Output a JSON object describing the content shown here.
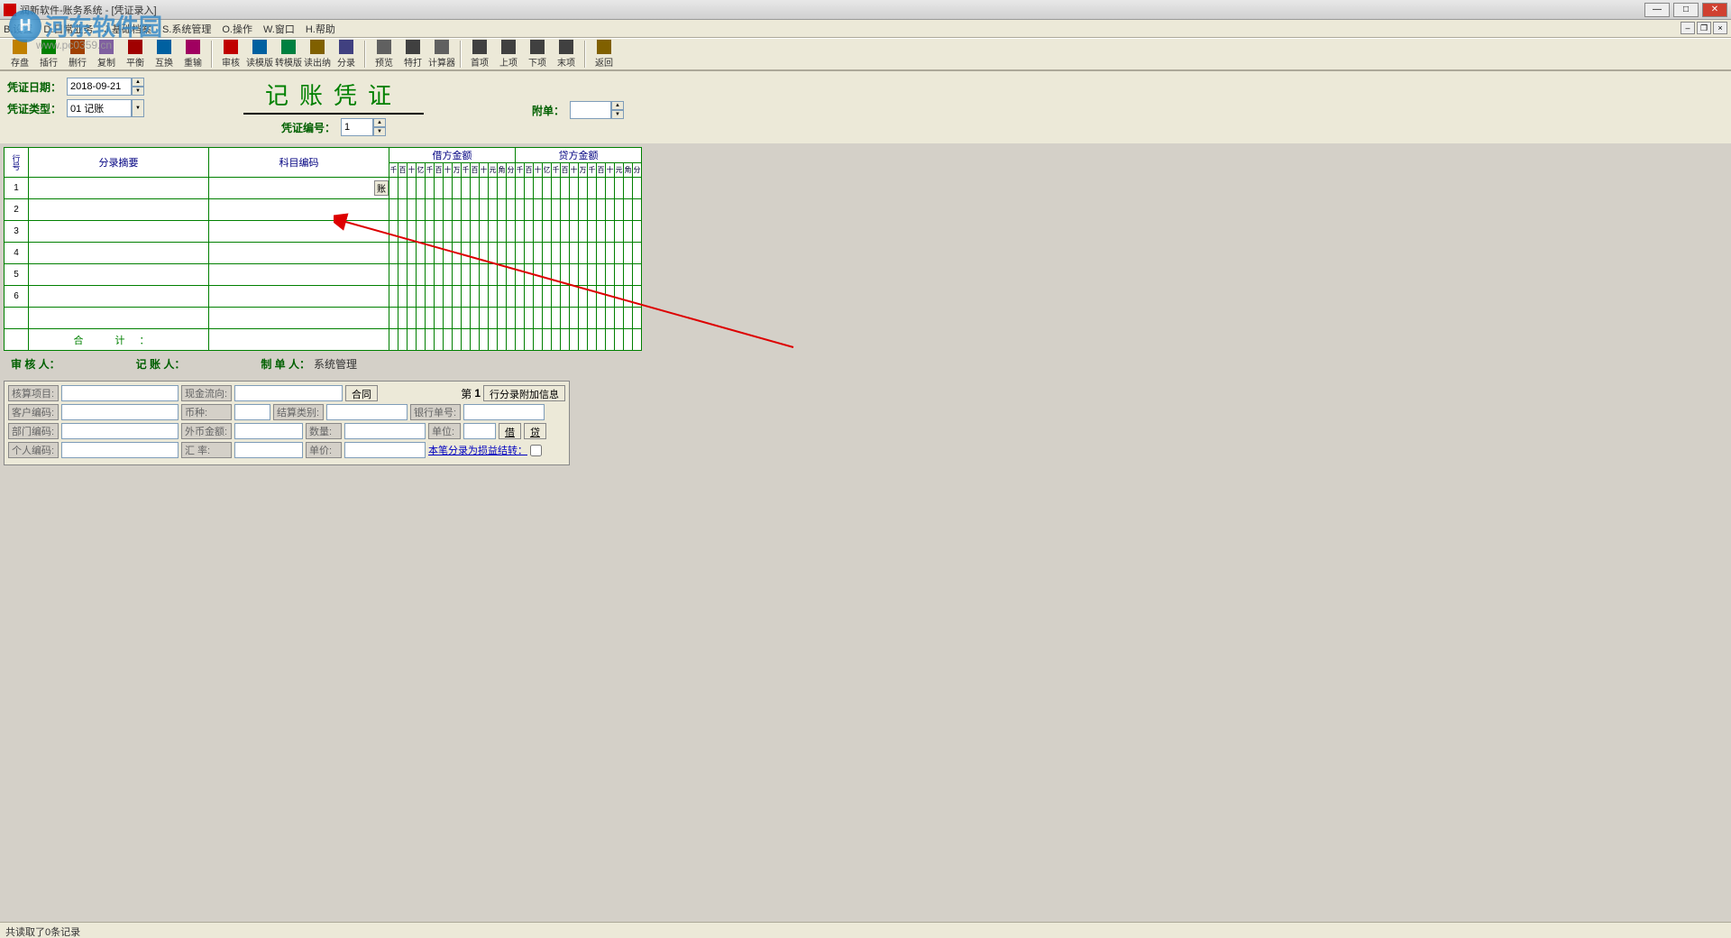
{
  "window": {
    "title": "润新软件-账务系统 - [凭证录入]"
  },
  "menu": {
    "items": [
      "B.设置",
      "D.日常业务",
      "J.基础档案",
      "S.系统管理",
      "O.操作",
      "W.窗口",
      "H.帮助"
    ]
  },
  "watermark": {
    "logo_text": "河东软件园",
    "url": "www.pc0359.cn",
    "logo_badge": "H"
  },
  "toolbar": {
    "groups": [
      [
        "存盘",
        "插行",
        "删行",
        "复制",
        "平衡",
        "互换",
        "重输"
      ],
      [
        "审核",
        "读模版",
        "转模版",
        "读出纳",
        "分录"
      ],
      [
        "预览",
        "特打",
        "计算器"
      ],
      [
        "首项",
        "上项",
        "下项",
        "末项"
      ],
      [
        "返回"
      ]
    ],
    "icons": [
      [
        "save",
        "insert-row",
        "delete-row",
        "copy",
        "balance",
        "swap",
        "redo"
      ],
      [
        "check",
        "read-tmpl",
        "to-tmpl",
        "read-cash",
        "entry"
      ],
      [
        "preview",
        "print",
        "calc"
      ],
      [
        "first",
        "prev",
        "next",
        "last"
      ],
      [
        "back"
      ]
    ],
    "colors": [
      [
        "#c08000",
        "#008000",
        "#a04000",
        "#8060a0",
        "#a00000",
        "#0060a0",
        "#a00060"
      ],
      [
        "#c00000",
        "#0060a0",
        "#008040",
        "#806000",
        "#404080"
      ],
      [
        "#606060",
        "#404040",
        "#606060"
      ],
      [
        "#404040",
        "#404040",
        "#404040",
        "#404040"
      ],
      [
        "#806000"
      ]
    ]
  },
  "form": {
    "date_label": "凭证日期：",
    "date_value": "2018-09-21",
    "type_label": "凭证类型：",
    "type_value": "01 记账",
    "title": "记账凭证",
    "num_label": "凭证编号：",
    "num_value": "1",
    "attach_label": "附单：",
    "attach_value": ""
  },
  "grid": {
    "col_xh": "行号",
    "col_summary": "分录摘要",
    "col_subject": "科目编码",
    "col_debit": "借方金额",
    "col_credit": "贷方金额",
    "digit_hdr": [
      "千",
      "百",
      "十",
      "亿",
      "千",
      "百",
      "十",
      "万",
      "千",
      "百",
      "十",
      "元",
      "角",
      "分"
    ],
    "zhang_btn": "账",
    "rows": [
      1,
      2,
      3,
      4,
      5,
      6
    ],
    "total_label": "合  计："
  },
  "signers": {
    "audit": "审 核 人：",
    "audit_v": "",
    "book": "记 账 人：",
    "book_v": "",
    "make": "制 单 人：",
    "make_v": "系统管理"
  },
  "panel": {
    "r1": {
      "l1": "核算项目:",
      "l2": "现金流向:",
      "btn": "合同",
      "num_lbl": "第",
      "num": "1",
      "btn2": "行分录附加信息"
    },
    "r2": {
      "l1": "客户编码:",
      "l2": "币种:",
      "l3": "结算类别:",
      "l4": "银行单号:"
    },
    "r3": {
      "l1": "部门编码:",
      "l2": "外币金额:",
      "l3": "数量:",
      "l4": "单位:",
      "btn1": "借",
      "btn2": "贷"
    },
    "r4": {
      "l1": "个人编码:",
      "l2": "汇  率:",
      "l3": "单价:",
      "link": "本笔分录为损益结转："
    }
  },
  "status": {
    "text": "共读取了0条记录"
  }
}
